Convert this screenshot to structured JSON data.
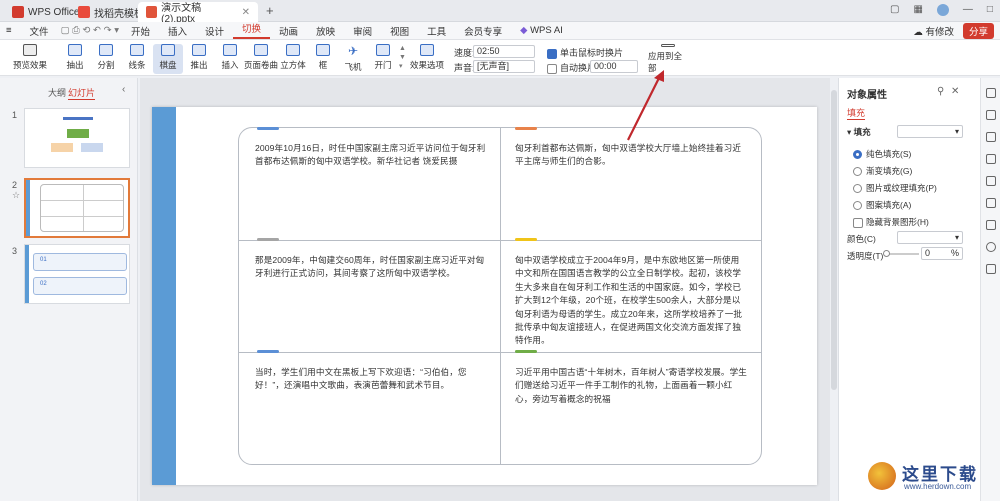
{
  "titlebar": {
    "app": "WPS Office",
    "tab2": "找稻壳模板",
    "tab3": "演示文稿(2).pptx",
    "add": "+"
  },
  "menubar": {
    "file": "文件",
    "items": [
      "开始",
      "插入",
      "设计",
      "切换",
      "动画",
      "放映",
      "审阅",
      "视图",
      "工具",
      "会员专享"
    ],
    "active": "切换",
    "ai": "WPS AI",
    "changes": "有修改",
    "share": "分享"
  },
  "ribbon": {
    "preview": "预览效果",
    "effects": [
      "抽出",
      "分割",
      "线条",
      "棋盘",
      "推出",
      "插入",
      "页面卷曲",
      "立方体",
      "框",
      "飞机",
      "开门"
    ],
    "selected": "棋盘",
    "effect_options": "效果选项",
    "speed_label": "速度:",
    "speed_value": "02:50",
    "sound_label": "声音:",
    "sound_value": "[无声音]",
    "on_click": "单击鼠标时换片",
    "auto": "自动换片:",
    "auto_value": "00:00",
    "apply_all": "应用到全部"
  },
  "leftpane": {
    "outline": "大纲",
    "slides": "幻灯片",
    "nums": [
      "1",
      "2",
      "3"
    ],
    "thumb3_items": [
      "01",
      "02"
    ]
  },
  "slide": {
    "cells": [
      {
        "text": "2009年10月16日，时任中国家副主席习近平访问位于匈牙利首都布达佩斯的匈中双语学校。新华社记者 饶爱民摄",
        "accent": "#5b8fd6"
      },
      {
        "text": "匈牙利首都布达佩斯，匈中双语学校大厅墙上始终挂着习近平主席与师生们的合影。",
        "accent": "#e8824a"
      },
      {
        "text": "那是2009年，中匈建交60周年，时任国家副主席习近平对匈牙利进行正式访问，其间考察了这所匈中双语学校。",
        "accent": "#a5a5a5"
      },
      {
        "text": "匈中双语学校成立于2004年9月，是中东欧地区第一所使用中文和所在国国语言教学的公立全日制学校。起初，该校学生大多来自在匈牙利工作和生活的中国家庭。如今，学校已扩大到12个年级，20个班，在校学生500余人，大部分是以匈牙利语为母语的学生。成立20年来，这所学校培养了一批批传承中匈友谊接班人，在促进两国文化交流方面发挥了独特作用。",
        "accent": "#f0c419"
      },
      {
        "text": "当时，学生们用中文在黑板上写下欢迎语：“习伯伯，您好！”，还演唱中文歌曲，表演芭蕾舞和武术节目。",
        "accent": "#5b8fd6"
      },
      {
        "text": "习近平用中国古语“十年树木，百年树人”寄语学校发展。学生们赠送给习近平一件手工制作的礼物，上面画着一颗小红心，旁边写着概念的祝福",
        "accent": "#70ad47"
      }
    ]
  },
  "rightpane": {
    "title": "对象属性",
    "tab": "填充",
    "section": "填充",
    "options": [
      "纯色填充(S)",
      "渐变填充(G)",
      "图片或纹理填充(P)",
      "图案填充(A)"
    ],
    "selected_option": "纯色填充(S)",
    "hide_bg": "隐藏背景图形(H)",
    "color_label": "颜色(C)",
    "transparency_label": "透明度(T)",
    "transparency_value": "0",
    "percent": "%"
  },
  "watermark": {
    "text": "这里下载",
    "url": "www.herdown.com"
  },
  "colors": {
    "brand_red": "#d23b2e",
    "slide_strip": "#5b9bd5",
    "selection": "#e27a3a"
  }
}
